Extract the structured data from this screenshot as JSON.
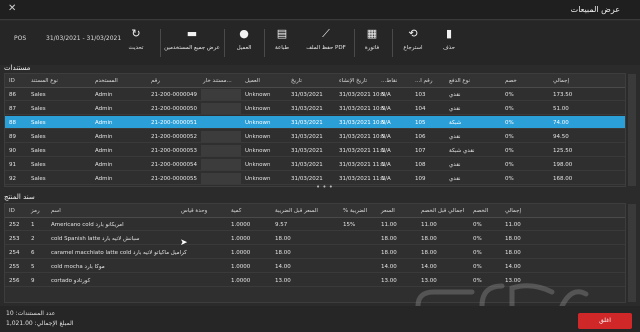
{
  "window": {
    "title": "عرض المبيعات",
    "close_icon": "close-icon"
  },
  "toolbar": {
    "pos_label": "POS",
    "date_range": "31/03/2021 - 31/03/2021",
    "buttons": [
      {
        "label": "تحديث",
        "icon": "refresh-icon",
        "glyph": "↻"
      },
      {
        "label": "عرض جميع المستخدمين",
        "icon": "users-icon",
        "glyph": "▬"
      },
      {
        "label": "العميل",
        "icon": "user-icon",
        "glyph": "●"
      },
      {
        "label": "طباعة",
        "icon": "printer-icon",
        "glyph": "▤"
      },
      {
        "label": "حفظ الملف PDF",
        "icon": "pdf-icon",
        "glyph": "⟋"
      },
      {
        "label": "فاتورة",
        "icon": "invoice-icon",
        "glyph": "▦"
      },
      {
        "label": "استرجاع",
        "icon": "return-icon",
        "glyph": "⟲"
      },
      {
        "label": "حذف",
        "icon": "trash-icon",
        "glyph": "▮"
      }
    ]
  },
  "documents": {
    "section_title": "مستندات",
    "columns": [
      "ID",
      "نوع المستند",
      "المستخدم",
      "رقم",
      "مستند خار...",
      "العميل",
      "تاريخ",
      "تاريخ الإنشاء",
      "...نقاط",
      "...رقم ا",
      "نوع الدفع",
      "خصم",
      "إجمالي"
    ],
    "rows": [
      [
        "86",
        "Sales",
        "Admin",
        "21-200-0000049",
        "",
        "Unknown",
        "31/03/2021",
        "31/03/2021 10:5",
        "N/A",
        "103",
        "نقدي",
        "0%",
        "173.50"
      ],
      [
        "87",
        "Sales",
        "Admin",
        "21-200-0000050",
        "",
        "Unknown",
        "31/03/2021",
        "31/03/2021 10:5",
        "N/A",
        "104",
        "نقدي",
        "0%",
        "51.00"
      ],
      [
        "88",
        "Sales",
        "Admin",
        "21-200-0000051",
        "",
        "Unknown",
        "31/03/2021",
        "31/03/2021 10:5",
        "N/A",
        "105",
        "شبكة",
        "0%",
        "74.00"
      ],
      [
        "89",
        "Sales",
        "Admin",
        "21-200-0000052",
        "",
        "Unknown",
        "31/03/2021",
        "31/03/2021 10:5",
        "N/A",
        "106",
        "نقدي",
        "0%",
        "94.50"
      ],
      [
        "90",
        "Sales",
        "Admin",
        "21-200-0000053",
        "",
        "Unknown",
        "31/03/2021",
        "31/03/2021 11:1",
        "N/A",
        "107",
        "نقدي شبكة",
        "0%",
        "125.50"
      ],
      [
        "91",
        "Sales",
        "Admin",
        "21-200-0000054",
        "",
        "Unknown",
        "31/03/2021",
        "31/03/2021 11:1",
        "N/A",
        "108",
        "نقدي",
        "0%",
        "198.00"
      ],
      [
        "92",
        "Sales",
        "Admin",
        "21-200-0000055",
        "",
        "Unknown",
        "31/03/2021",
        "31/03/2021 11:1",
        "N/A",
        "109",
        "نقدي",
        "0%",
        "168.00"
      ]
    ],
    "selected_row": 2
  },
  "products": {
    "section_title": "سند المنتج",
    "columns": [
      "ID",
      "رمز",
      "اسم",
      "وحدة قياس",
      "كمية",
      "السعر قبل الضريبة",
      "% الضريبة",
      "السعر",
      "اجمالي قبل الخصم",
      "الخصم",
      "إجمالي"
    ],
    "rows": [
      [
        "252",
        "1",
        "Americano cold امريكانو بارد",
        "",
        "1.0000",
        "9.57",
        "15%",
        "11.00",
        "11.00",
        "0%",
        "11.00"
      ],
      [
        "253",
        "2",
        "cold Spanish latte سبانش لاتيه بارد",
        "",
        "1.0000",
        "18.00",
        "",
        "18.00",
        "18.00",
        "0%",
        "18.00"
      ],
      [
        "254",
        "6",
        "caramel macchiato latte cold كراميل ماكياتو لاتيه بارد",
        "",
        "1.0000",
        "18.00",
        "",
        "18.00",
        "18.00",
        "0%",
        "18.00"
      ],
      [
        "255",
        "5",
        "cold mocha موكا بارد",
        "",
        "1.0000",
        "14.00",
        "",
        "14.00",
        "14.00",
        "0%",
        "14.00"
      ],
      [
        "256",
        "9",
        "cortado كورتادو",
        "",
        "1.0000",
        "13.00",
        "",
        "13.00",
        "13.00",
        "0%",
        "13.00"
      ]
    ]
  },
  "footer": {
    "count_text": "عدد المستندات: 10",
    "total_text": "المبلغ الإجمالي: 1,021.00",
    "close_label": "اغلق"
  },
  "watermark": {
    "text": "حراج"
  },
  "colors": {
    "accent": "#2b9fd8",
    "close_button": "#d02828",
    "background": "#2b2b2b"
  }
}
